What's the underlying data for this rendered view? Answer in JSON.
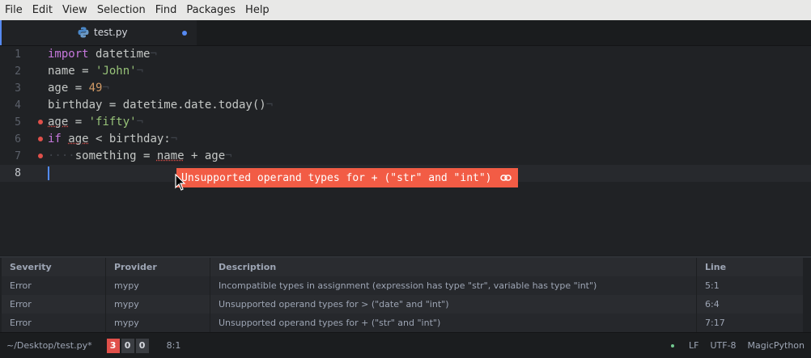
{
  "menu": [
    "File",
    "Edit",
    "View",
    "Selection",
    "Find",
    "Packages",
    "Help"
  ],
  "tab": {
    "title": "test.py",
    "icon": "python-file-icon"
  },
  "editor": {
    "line_numbers": [
      "1",
      "2",
      "3",
      "4",
      "5",
      "6",
      "7",
      "8"
    ],
    "current_line": 8,
    "error_lines": [
      5,
      6,
      7
    ]
  },
  "tooltip": {
    "message": "Unsupported operand types for + (\"str\" and \"int\")",
    "icon": "link-icon"
  },
  "panel": {
    "headers": [
      "Severity",
      "Provider",
      "Description",
      "Line"
    ],
    "rows": [
      [
        "Error",
        "mypy",
        "Incompatible types in assignment (expression has type \"str\", variable has type \"int\")",
        "5:1"
      ],
      [
        "Error",
        "mypy",
        "Unsupported operand types for > (\"date\" and \"int\")",
        "6:4"
      ],
      [
        "Error",
        "mypy",
        "Unsupported operand types for + (\"str\" and \"int\")",
        "7:17"
      ]
    ]
  },
  "status": {
    "path": "~/Desktop/test.py*",
    "errors": "3",
    "warnings": "0",
    "infos": "0",
    "cursor": "8:1",
    "line_ending": "LF",
    "encoding": "UTF-8",
    "grammar": "MagicPython"
  },
  "colors": {
    "accent": "#568af2",
    "error": "#e0504a",
    "tooltip_bg": "#f25c45"
  }
}
